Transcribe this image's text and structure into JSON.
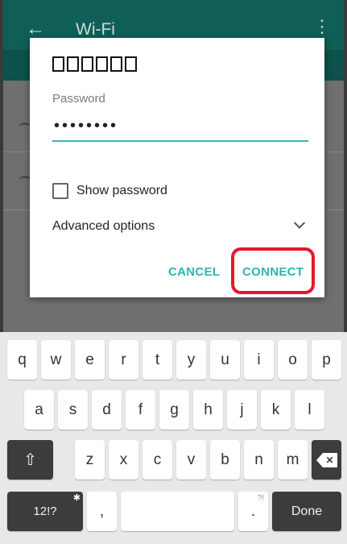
{
  "background": {
    "title": "Wi-Fi",
    "back_icon": "arrow-back-icon",
    "menu_icon": "overflow-menu-icon"
  },
  "dialog": {
    "network_name_glyph_count": 6,
    "password_label": "Password",
    "password_value": "••••••••",
    "show_password_label": "Show password",
    "show_password_checked": false,
    "advanced_label": "Advanced options",
    "cancel_label": "CANCEL",
    "connect_label": "CONNECT",
    "accent_color": "#2bb5b0",
    "highlight_color": "#e8162b"
  },
  "keyboard": {
    "row1": [
      "q",
      "w",
      "e",
      "r",
      "t",
      "y",
      "u",
      "i",
      "o",
      "p"
    ],
    "row2": [
      "a",
      "s",
      "d",
      "f",
      "g",
      "h",
      "j",
      "k",
      "l"
    ],
    "row3": [
      "z",
      "x",
      "c",
      "v",
      "b",
      "n",
      "m"
    ],
    "symbols_label": "12!?",
    "comma_label": ",",
    "period_label": ".",
    "period_hint": "?!",
    "done_label": "Done"
  }
}
